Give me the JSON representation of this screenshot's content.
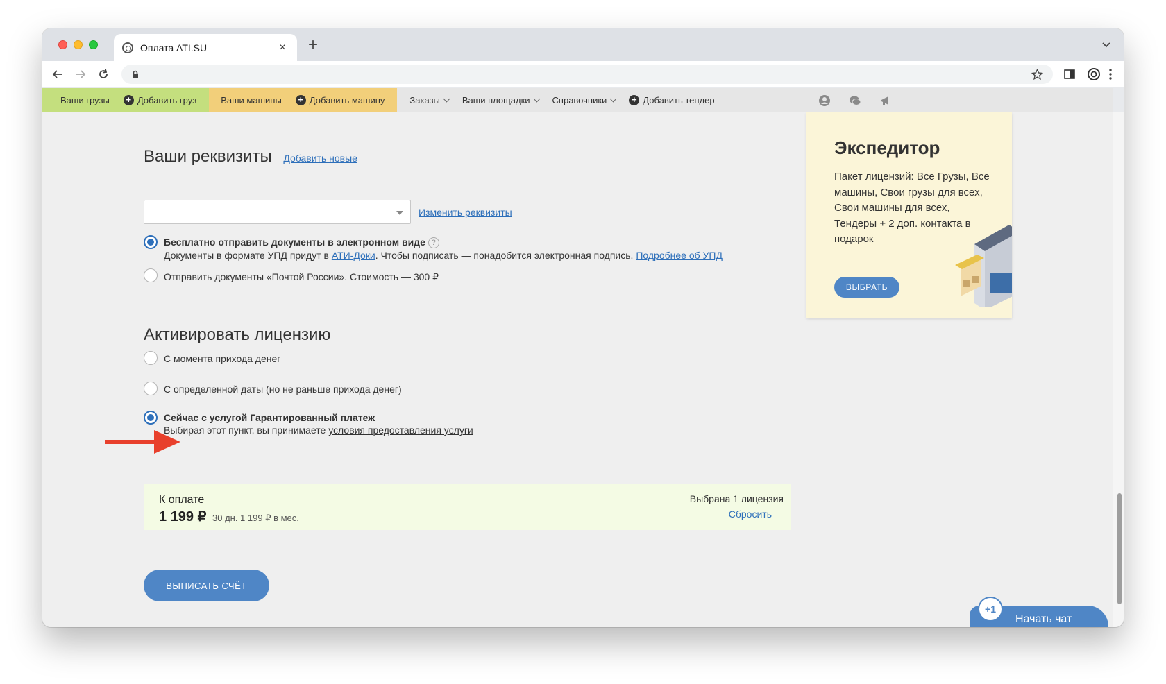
{
  "browser": {
    "tab_title": "Оплата ATI.SU",
    "tab_close": "×",
    "new_tab": "+"
  },
  "sitenav": {
    "cargo": "Ваши грузы",
    "add_cargo": "Добавить груз",
    "trucks": "Ваши машины",
    "add_truck": "Добавить машину",
    "menus": [
      "Заказы",
      "Ваши площадки",
      "Справочники"
    ],
    "add_tender": "Добавить тендер"
  },
  "requisites": {
    "title": "Ваши реквизиты",
    "add_new": "Добавить новые",
    "select_value": "",
    "change": "Изменить реквизиты"
  },
  "delivery": {
    "electronic_label": "Бесплатно отправить документы в электронном виде",
    "help": "?",
    "electronic_sub_prefix": "Документы в формате УПД придут в ",
    "electronic_sub_link": "АТИ-Доки",
    "electronic_sub_mid": ". Чтобы подписать — понадобится электронная подпись. ",
    "electronic_sub_more": "Подробнее об УПД",
    "post_label": "Отправить документы «Почтой России». Стоимость — 300 ₽"
  },
  "activation": {
    "title": "Активировать лицензию",
    "option1": "С момента прихода денег",
    "option2": "С определенной даты (но не раньше прихода денег)",
    "option3_prefix": "Сейчас с услугой ",
    "option3_link": "Гарантированный платеж",
    "option3_sub_prefix": "Выбирая этот пункт, вы принимаете ",
    "option3_sub_link": "условия предоставления услуги"
  },
  "total": {
    "label": "К оплате",
    "amount": "1 199 ₽",
    "meta": "30 дн.  1 199 ₽ в мес.",
    "selected": "Выбрана 1 лицензия",
    "reset": "Сбросить"
  },
  "invoice_button": "ВЫПИСАТЬ СЧЁТ",
  "promo": {
    "title": "Экспедитор",
    "text": "Пакет лицензий: Все Грузы, Все машины, Свои грузы для всех, Свои машины для всех, Тендеры + 2 доп. контакта в подарок",
    "button": "ВЫБРАТЬ"
  },
  "chat": {
    "badge": "+1",
    "label": "Начать чат"
  },
  "colors": {
    "accent": "#2d6fba",
    "button": "#4f86c6",
    "annotation_arrow": "#e8402c",
    "nav_green": "#c4df7e",
    "nav_yellow": "#f2cf7a"
  }
}
